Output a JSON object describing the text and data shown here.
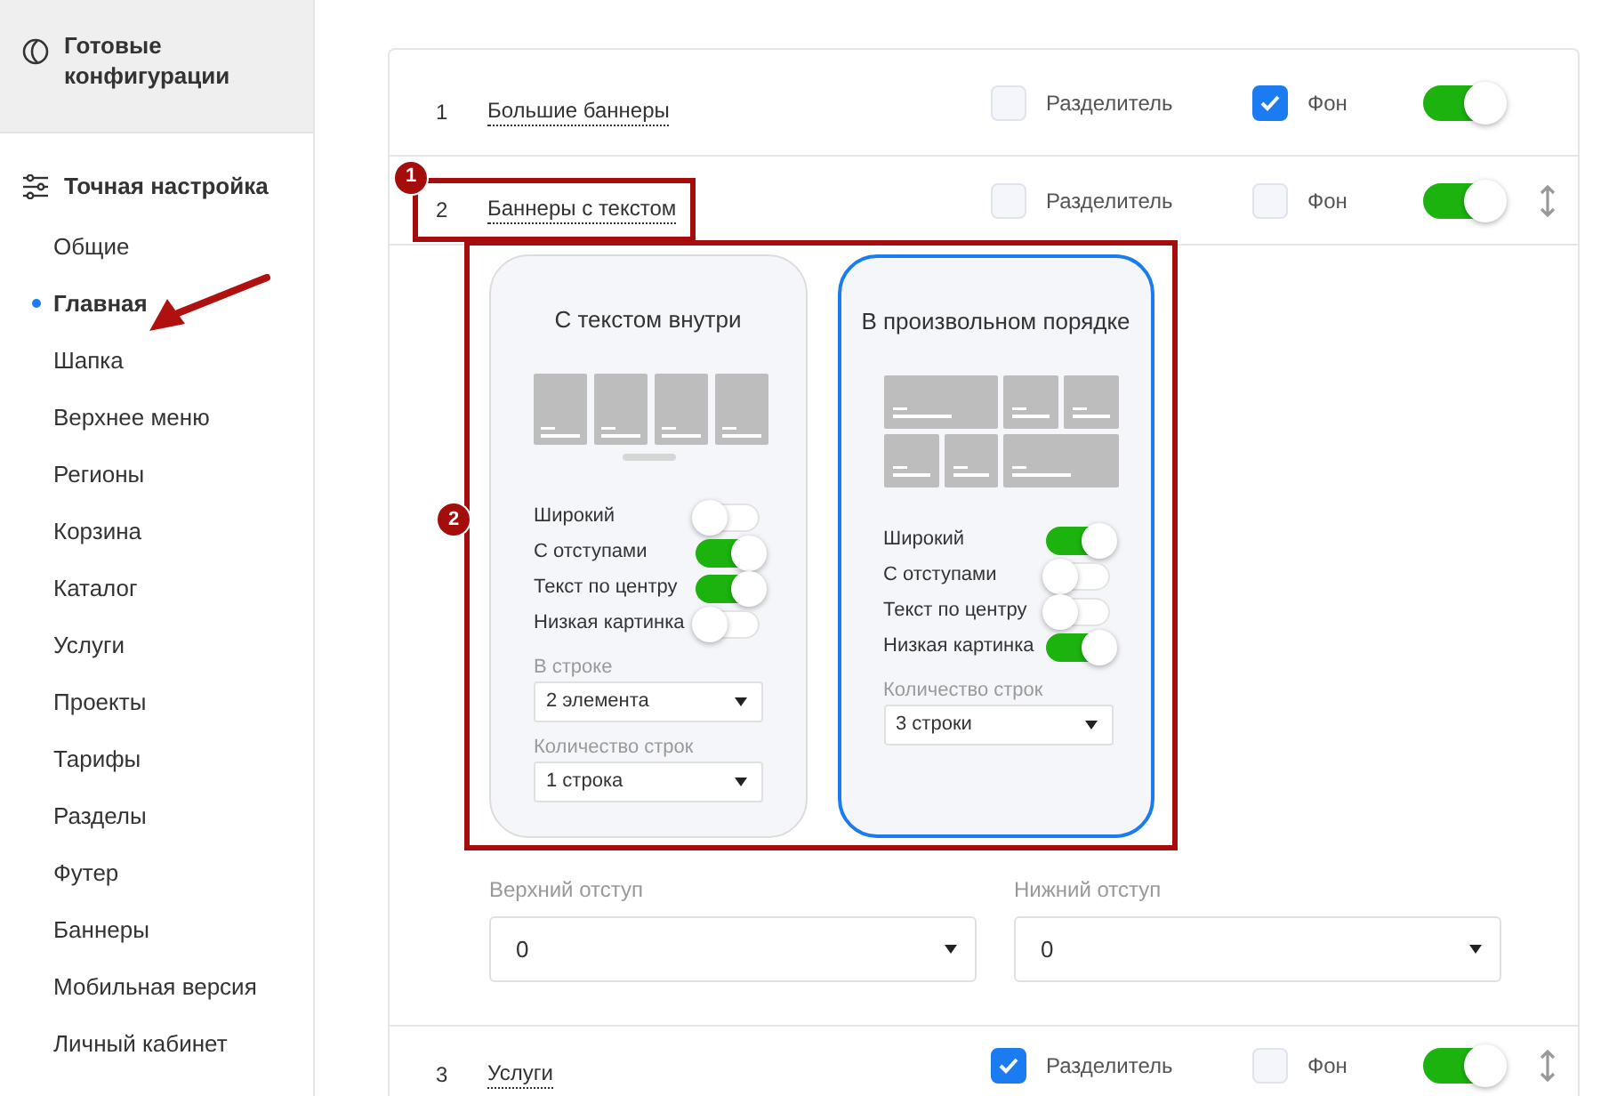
{
  "sidebar": {
    "presets": {
      "label": "Готовые конфигурации"
    },
    "section": {
      "label": "Точная настройка"
    },
    "items": [
      {
        "label": "Общие",
        "selected": false,
        "annotated": false
      },
      {
        "label": "Главная",
        "selected": true,
        "annotated": true
      },
      {
        "label": "Шапка",
        "selected": false,
        "annotated": false
      },
      {
        "label": "Верхнее меню",
        "selected": false,
        "annotated": false
      },
      {
        "label": "Регионы",
        "selected": false,
        "annotated": false
      },
      {
        "label": "Корзина",
        "selected": false,
        "annotated": false
      },
      {
        "label": "Каталог",
        "selected": false,
        "annotated": false
      },
      {
        "label": "Услуги",
        "selected": false,
        "annotated": false
      },
      {
        "label": "Проекты",
        "selected": false,
        "annotated": false
      },
      {
        "label": "Тарифы",
        "selected": false,
        "annotated": false
      },
      {
        "label": "Разделы",
        "selected": false,
        "annotated": false
      },
      {
        "label": "Футер",
        "selected": false,
        "annotated": false
      },
      {
        "label": "Баннеры",
        "selected": false,
        "annotated": false
      },
      {
        "label": "Мобильная версия",
        "selected": false,
        "annotated": false
      },
      {
        "label": "Личный кабинет",
        "selected": false,
        "annotated": false
      }
    ]
  },
  "blocks": [
    {
      "number": "1",
      "title": "Большие баннеры",
      "divider": {
        "label": "Разделитель",
        "checked": false
      },
      "background": {
        "label": "Фон",
        "checked": true
      },
      "on": true,
      "drag_handle": false
    },
    {
      "number": "2",
      "title": "Баннеры с текстом",
      "callout": "1",
      "divider": {
        "label": "Разделитель",
        "checked": false
      },
      "background": {
        "label": "Фон",
        "checked": false
      },
      "on": true,
      "drag_handle": true,
      "expanded": {
        "callout": "2",
        "variants": [
          {
            "title": "С текстом внутри",
            "selected": false,
            "kind": "row",
            "toggles": [
              {
                "label": "Широкий",
                "on": false
              },
              {
                "label": "С отступами",
                "on": true
              },
              {
                "label": "Текст по центру",
                "on": true
              },
              {
                "label": "Низкая картинка",
                "on": false
              }
            ],
            "selects": [
              {
                "label": "В строке",
                "value": "2 элемента"
              },
              {
                "label": "Количество строк",
                "value": "1 строка"
              }
            ]
          },
          {
            "title": "В произвольном порядке",
            "selected": true,
            "kind": "mosaic",
            "toggles": [
              {
                "label": "Широкий",
                "on": true
              },
              {
                "label": "С отступами",
                "on": false
              },
              {
                "label": "Текст по центру",
                "on": false
              },
              {
                "label": "Низкая картинка",
                "on": true
              }
            ],
            "selects": [
              {
                "label": "Количество строк",
                "value": "3 строки"
              }
            ]
          }
        ],
        "fields": [
          {
            "label": "Верхний отступ",
            "value": "0"
          },
          {
            "label": "Нижний отступ",
            "value": "0"
          }
        ]
      }
    },
    {
      "number": "3",
      "title": "Услуги",
      "divider": {
        "label": "Разделитель",
        "checked": true
      },
      "background": {
        "label": "Фон",
        "checked": false
      },
      "on": true,
      "drag_handle": true
    }
  ]
}
